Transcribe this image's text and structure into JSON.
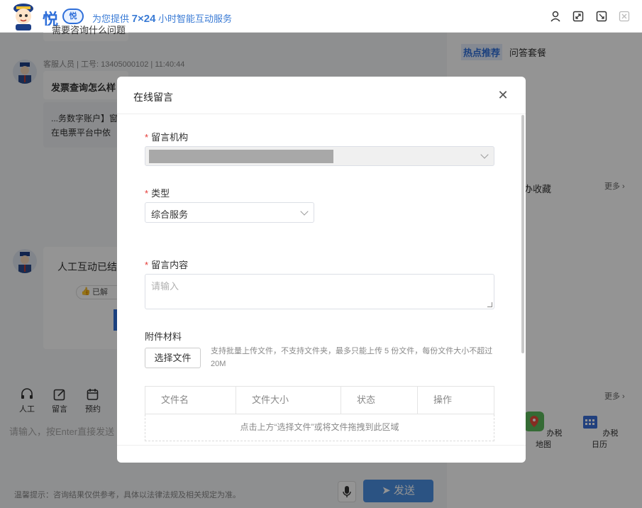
{
  "window": {
    "brand": "悦",
    "brand_badge": "悦",
    "slogan_prefix": "为您提供 ",
    "slogan_bold": "7×24",
    "slogan_suffix": " 小时智能互动服务"
  },
  "chat": {
    "top_bubble": "需要咨询什么问题",
    "agent_meta": "客服人员 | 工号: 13405000102 | 11:40:44",
    "question_title": "发票查询怎么样",
    "answer_line1": "...务数字账户】窗",
    "answer_line2": "在电票平台中依",
    "ended_text": "人工互动已结",
    "ended_badge": "已解",
    "tools": [
      {
        "label": "人工"
      },
      {
        "label": "留言"
      },
      {
        "label": "预约"
      }
    ],
    "input_placeholder": "请输入，按Enter直接发送",
    "tip": "温馨提示：咨询结果仅供参考，具体以法律法规及相关规定为准。",
    "send_label": "发送"
  },
  "right": {
    "tab_hot": "热点推荐",
    "tab_qa": "问答套餐",
    "fav_label": "办收藏",
    "more1": "更多",
    "more2": "更多",
    "services": [
      {
        "label": "办税地图"
      },
      {
        "label": "办税日历"
      }
    ]
  },
  "modal": {
    "title": "在线留言",
    "org_label": "留言机构",
    "type_label": "类型",
    "type_value": "综合服务",
    "content_label": "留言内容",
    "content_placeholder": "请输入",
    "attach_label": "附件材料",
    "file_button": "选择文件",
    "file_hint": "支持批量上传文件，不支持文件夹，最多只能上传 5 份文件，每份文件大小不超过20M",
    "table_headers": [
      "文件名",
      "文件大小",
      "状态",
      "操作"
    ],
    "drop_hint": "点击上方“选择文件”或将文件拖拽到此区域"
  },
  "colors": {
    "brand_blue": "#2f6fd9",
    "required": "#e53935",
    "send_button": "#4a90e2"
  }
}
